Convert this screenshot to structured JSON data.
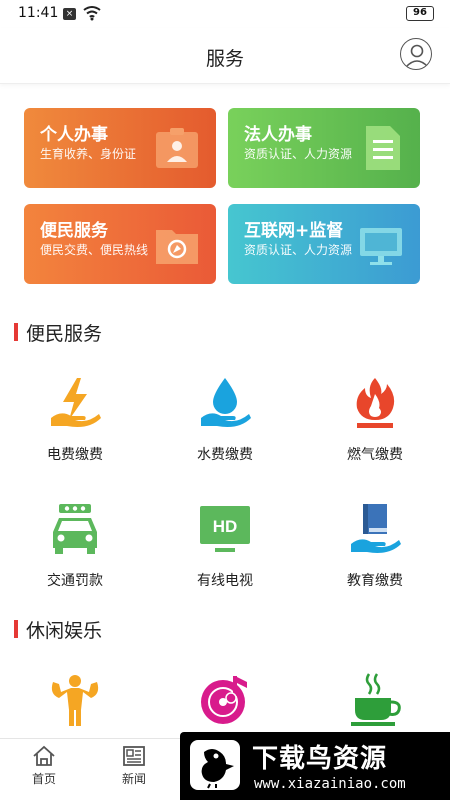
{
  "status_bar": {
    "time": "11:41",
    "notification_icon": "x-notification-icon",
    "wifi_icon": "wifi-icon",
    "battery": "96"
  },
  "header": {
    "title": "服务",
    "avatar_icon": "user-avatar-icon"
  },
  "cards": [
    {
      "title": "个人办事",
      "subtitle": "生育收养、身份证",
      "icon": "id-card-icon",
      "color": "#ea6a33"
    },
    {
      "title": "法人办事",
      "subtitle": "资质认证、人力资源",
      "icon": "document-icon",
      "color": "#62bf52"
    },
    {
      "title": "便民服务",
      "subtitle": "便民交费、便民热线",
      "icon": "folder-icon",
      "color": "#ee6c3a"
    },
    {
      "title": "互联网+监督",
      "subtitle": "资质认证、人力资源",
      "icon": "monitor-icon",
      "color": "#40b0d1"
    }
  ],
  "sections": {
    "convenience": {
      "title": "便民服务",
      "items": [
        {
          "label": "电费缴费",
          "icon": "electricity-icon"
        },
        {
          "label": "水费缴费",
          "icon": "water-icon"
        },
        {
          "label": "燃气缴费",
          "icon": "gas-flame-icon"
        },
        {
          "label": "交通罚款",
          "icon": "car-icon"
        },
        {
          "label": "有线电视",
          "icon": "hd-tv-icon"
        },
        {
          "label": "教育缴费",
          "icon": "book-icon"
        }
      ]
    },
    "leisure": {
      "title": "休闲娱乐",
      "items": [
        {
          "label": "",
          "icon": "fitness-icon"
        },
        {
          "label": "",
          "icon": "music-icon"
        },
        {
          "label": "",
          "icon": "tea-icon"
        }
      ]
    }
  },
  "bottom_nav": [
    {
      "label": "首页",
      "icon": "home-icon"
    },
    {
      "label": "新闻",
      "icon": "news-icon"
    }
  ],
  "watermark": {
    "title": "下载鸟资源",
    "url": "www.xiazainiao.com"
  },
  "colors": {
    "accent_red": "#e53935",
    "orange": "#f5a623",
    "blue": "#1aa3de",
    "green": "#5cb85c"
  }
}
